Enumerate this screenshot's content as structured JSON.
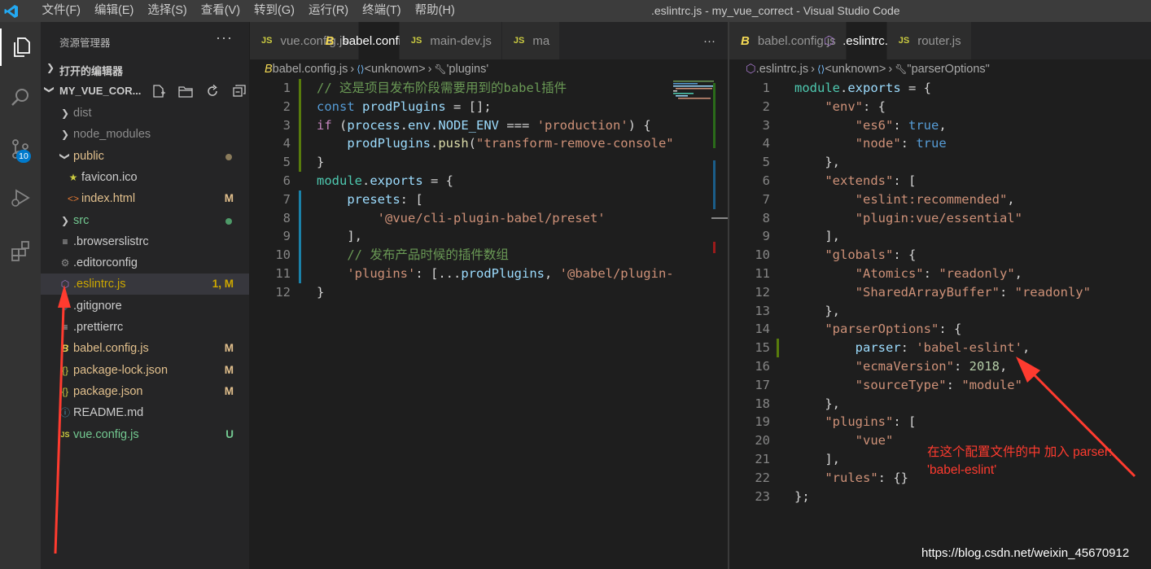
{
  "titlebar": {
    "menu": [
      "文件(F)",
      "编辑(E)",
      "选择(S)",
      "查看(V)",
      "转到(G)",
      "运行(R)",
      "终端(T)",
      "帮助(H)"
    ],
    "window_title": ".eslintrc.js - my_vue_correct - Visual Studio Code"
  },
  "activity": {
    "source_control_badge": "10"
  },
  "sidebar": {
    "title": "资源管理器",
    "open_editors": "打开的编辑器",
    "project": "MY_VUE_COR...",
    "items": [
      {
        "name": "dist",
        "kind": "folder",
        "status": "",
        "color": "#8c8c8c"
      },
      {
        "name": "node_modules",
        "kind": "folder",
        "status": "",
        "color": "#8c8c8c"
      },
      {
        "name": "public",
        "kind": "folder-open",
        "status": "",
        "color": "#e2c08d"
      },
      {
        "name": "favicon.ico",
        "kind": "star",
        "status": "",
        "color": "#cccccc"
      },
      {
        "name": "index.html",
        "kind": "html",
        "status": "M",
        "color": "#e2c08d"
      },
      {
        "name": "src",
        "kind": "folder",
        "status": "",
        "color": "#73c991"
      },
      {
        "name": ".browserslistrc",
        "kind": "lines",
        "status": "",
        "color": "#cccccc"
      },
      {
        "name": ".editorconfig",
        "kind": "gear",
        "status": "",
        "color": "#cccccc"
      },
      {
        "name": ".eslintrc.js",
        "kind": "eslint",
        "status": "1, M",
        "color": "#cca700"
      },
      {
        "name": ".gitignore",
        "kind": "git",
        "status": "",
        "color": "#cccccc"
      },
      {
        "name": ".prettierrc",
        "kind": "lines",
        "status": "",
        "color": "#cccccc"
      },
      {
        "name": "babel.config.js",
        "kind": "babel",
        "status": "M",
        "color": "#e2c08d"
      },
      {
        "name": "package-lock.json",
        "kind": "json",
        "status": "M",
        "color": "#e2c08d"
      },
      {
        "name": "package.json",
        "kind": "json",
        "status": "M",
        "color": "#e2c08d"
      },
      {
        "name": "README.md",
        "kind": "info",
        "status": "",
        "color": "#cccccc"
      },
      {
        "name": "vue.config.js",
        "kind": "js",
        "status": "U",
        "color": "#73c991"
      }
    ]
  },
  "left_editor": {
    "tabs": [
      {
        "icon": "JS",
        "label": "vue.config.js",
        "active": false,
        "close": ""
      },
      {
        "icon": "B",
        "label": "babel.config.js",
        "active": true,
        "close": "×"
      },
      {
        "icon": "JS",
        "label": "main-dev.js",
        "active": false,
        "close": ""
      },
      {
        "icon": "JS",
        "label": "ma",
        "active": false,
        "close": ""
      }
    ],
    "more": "···",
    "breadcrumb": [
      "babel.config.js",
      "<unknown>",
      "'plugins'"
    ],
    "lines": [
      {
        "n": "1",
        "toks": [
          [
            "c",
            "// 这是项目发布阶段需要用到的babel插件"
          ]
        ]
      },
      {
        "n": "2",
        "toks": [
          [
            "k",
            "const"
          ],
          [
            "p",
            " "
          ],
          [
            "v",
            "prodPlugins"
          ],
          [
            "p",
            " = [];"
          ]
        ]
      },
      {
        "n": "3",
        "toks": [
          [
            "kw",
            "if"
          ],
          [
            "p",
            " ("
          ],
          [
            "v",
            "process"
          ],
          [
            "p",
            "."
          ],
          [
            "v",
            "env"
          ],
          [
            "p",
            "."
          ],
          [
            "v",
            "NODE_ENV"
          ],
          [
            "p",
            " === "
          ],
          [
            "s",
            "'production'"
          ],
          [
            "p",
            ") {"
          ]
        ]
      },
      {
        "n": "4",
        "toks": [
          [
            "p",
            "    "
          ],
          [
            "v",
            "prodPlugins"
          ],
          [
            "p",
            "."
          ],
          [
            "f",
            "push"
          ],
          [
            "p",
            "("
          ],
          [
            "s",
            "\"transform-remove-console\""
          ]
        ]
      },
      {
        "n": "5",
        "toks": [
          [
            "p",
            "}"
          ]
        ]
      },
      {
        "n": "6",
        "toks": [
          [
            "t",
            "module"
          ],
          [
            "p",
            "."
          ],
          [
            "v",
            "exports"
          ],
          [
            "p",
            " = {"
          ]
        ]
      },
      {
        "n": "7",
        "toks": [
          [
            "p",
            "    "
          ],
          [
            "v",
            "presets"
          ],
          [
            "p",
            ": ["
          ]
        ]
      },
      {
        "n": "8",
        "toks": [
          [
            "p",
            "        "
          ],
          [
            "s",
            "'@vue/cli-plugin-babel/preset'"
          ]
        ]
      },
      {
        "n": "9",
        "toks": [
          [
            "p",
            "    ],"
          ]
        ]
      },
      {
        "n": "10",
        "toks": [
          [
            "p",
            "    "
          ],
          [
            "c",
            "// 发布产品时候的插件数组"
          ]
        ]
      },
      {
        "n": "11",
        "toks": [
          [
            "p",
            "    "
          ],
          [
            "s",
            "'plugins'"
          ],
          [
            "p",
            ": [..."
          ],
          [
            "v",
            "prodPlugins"
          ],
          [
            "p",
            ", "
          ],
          [
            "s",
            "'@babel/plugin-"
          ]
        ]
      },
      {
        "n": "12",
        "toks": [
          [
            "p",
            "}"
          ]
        ]
      }
    ]
  },
  "right_editor": {
    "tabs": [
      {
        "icon": "B",
        "label": "babel.config.js",
        "active": false,
        "close": ""
      },
      {
        "icon": "E",
        "label": ".eslintrc.js",
        "active": true,
        "close": "×"
      },
      {
        "icon": "JS",
        "label": "router.js",
        "active": false,
        "close": ""
      }
    ],
    "breadcrumb": [
      ".eslintrc.js",
      "<unknown>",
      "\"parserOptions\""
    ],
    "lines": [
      {
        "n": "1",
        "toks": [
          [
            "t",
            "module"
          ],
          [
            "p",
            "."
          ],
          [
            "v",
            "exports"
          ],
          [
            "p",
            " = {"
          ]
        ]
      },
      {
        "n": "2",
        "toks": [
          [
            "p",
            "    "
          ],
          [
            "s",
            "\"env\""
          ],
          [
            "p",
            ": {"
          ]
        ]
      },
      {
        "n": "3",
        "toks": [
          [
            "p",
            "        "
          ],
          [
            "s",
            "\"es6\""
          ],
          [
            "p",
            ": "
          ],
          [
            "kc",
            "true"
          ],
          [
            "p",
            ","
          ]
        ]
      },
      {
        "n": "4",
        "toks": [
          [
            "p",
            "        "
          ],
          [
            "s",
            "\"node\""
          ],
          [
            "p",
            ": "
          ],
          [
            "kc",
            "true"
          ]
        ]
      },
      {
        "n": "5",
        "toks": [
          [
            "p",
            "    },"
          ]
        ]
      },
      {
        "n": "6",
        "toks": [
          [
            "p",
            "    "
          ],
          [
            "s",
            "\"extends\""
          ],
          [
            "p",
            ": ["
          ]
        ]
      },
      {
        "n": "7",
        "toks": [
          [
            "p",
            "        "
          ],
          [
            "s",
            "\"eslint:recommended\""
          ],
          [
            "p",
            ","
          ]
        ]
      },
      {
        "n": "8",
        "toks": [
          [
            "p",
            "        "
          ],
          [
            "s",
            "\"plugin:vue/essential\""
          ]
        ]
      },
      {
        "n": "9",
        "toks": [
          [
            "p",
            "    ],"
          ]
        ]
      },
      {
        "n": "10",
        "toks": [
          [
            "p",
            "    "
          ],
          [
            "s",
            "\"globals\""
          ],
          [
            "p",
            ": {"
          ]
        ]
      },
      {
        "n": "11",
        "toks": [
          [
            "p",
            "        "
          ],
          [
            "s",
            "\"Atomics\""
          ],
          [
            "p",
            ": "
          ],
          [
            "s",
            "\"readonly\""
          ],
          [
            "p",
            ","
          ]
        ]
      },
      {
        "n": "12",
        "toks": [
          [
            "p",
            "        "
          ],
          [
            "s",
            "\"SharedArrayBuffer\""
          ],
          [
            "p",
            ": "
          ],
          [
            "s",
            "\"readonly\""
          ]
        ]
      },
      {
        "n": "13",
        "toks": [
          [
            "p",
            "    },"
          ]
        ]
      },
      {
        "n": "14",
        "toks": [
          [
            "p",
            "    "
          ],
          [
            "s",
            "\"parserOptions\""
          ],
          [
            "p",
            ": {"
          ]
        ]
      },
      {
        "n": "15",
        "toks": [
          [
            "p",
            "        "
          ],
          [
            "v",
            "parser"
          ],
          [
            "p",
            ": "
          ],
          [
            "s",
            "'babel-eslint'"
          ],
          [
            "p",
            ","
          ]
        ]
      },
      {
        "n": "16",
        "toks": [
          [
            "p",
            "        "
          ],
          [
            "s",
            "\"ecmaVersion\""
          ],
          [
            "p",
            ": "
          ],
          [
            "n",
            "2018"
          ],
          [
            "p",
            ","
          ]
        ]
      },
      {
        "n": "17",
        "toks": [
          [
            "p",
            "        "
          ],
          [
            "s",
            "\"sourceType\""
          ],
          [
            "p",
            ": "
          ],
          [
            "s",
            "\"module\""
          ]
        ]
      },
      {
        "n": "18",
        "toks": [
          [
            "p",
            "    },"
          ]
        ]
      },
      {
        "n": "19",
        "toks": [
          [
            "p",
            "    "
          ],
          [
            "s",
            "\"plugins\""
          ],
          [
            "p",
            ": ["
          ]
        ]
      },
      {
        "n": "20",
        "toks": [
          [
            "p",
            "        "
          ],
          [
            "s",
            "\"vue\""
          ]
        ]
      },
      {
        "n": "21",
        "toks": [
          [
            "p",
            "    ],"
          ]
        ]
      },
      {
        "n": "22",
        "toks": [
          [
            "p",
            "    "
          ],
          [
            "s",
            "\"rules\""
          ],
          [
            "p",
            ": {}"
          ]
        ]
      },
      {
        "n": "23",
        "toks": [
          [
            "p",
            "};"
          ]
        ]
      }
    ]
  },
  "annotation": "在这个配置文件的中 加入 parser: 'babel-eslint'",
  "watermark": "https://blog.csdn.net/weixin_45670912",
  "colors": {
    "accent": "#007acc",
    "annotation_red": "#ff3b2f",
    "modified": "#e2c08d",
    "untracked": "#73c991",
    "warning": "#cca700"
  }
}
